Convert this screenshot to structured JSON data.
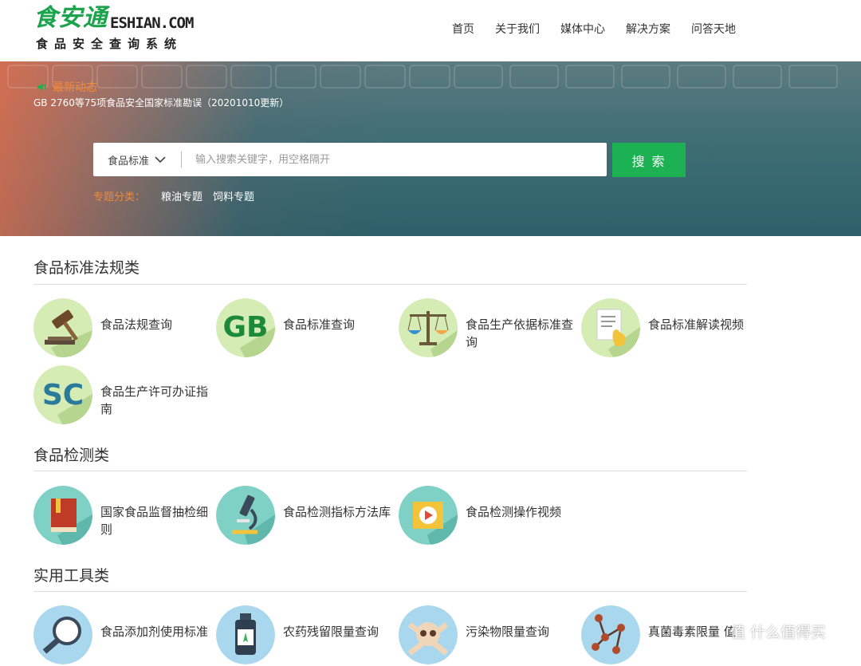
{
  "logo": {
    "main": "食安通",
    "domain": "ESHIAN.COM",
    "subtitle": "食品安全查询系统"
  },
  "nav": [
    "首页",
    "关于我们",
    "媒体中心",
    "解决方案",
    "问答天地"
  ],
  "news": {
    "heading": "最新动态",
    "text": "GB 2760等75项食品安全国家标准勘误（20201010更新）"
  },
  "search": {
    "category": "食品标准",
    "placeholder": "输入搜索关键字，用空格隔开",
    "button": "搜 索"
  },
  "topics": {
    "label": "专题分类：",
    "items": [
      "粮油专题",
      "饲料专题"
    ]
  },
  "sections": [
    {
      "title": "食品标准法规类",
      "items": [
        {
          "label": "食品法规查询",
          "icon": "gavel-icon"
        },
        {
          "label": "食品标准查询",
          "icon": "gb-icon"
        },
        {
          "label": "食品生产依据标准查询",
          "icon": "scale-icon"
        },
        {
          "label": "食品标准解读视频",
          "icon": "document-hand-icon"
        },
        {
          "label": "食品生产许可办证指南",
          "icon": "sc-icon"
        }
      ]
    },
    {
      "title": "食品检测类",
      "items": [
        {
          "label": "国家食品监督抽检细则",
          "icon": "book-icon"
        },
        {
          "label": "食品检测指标方法库",
          "icon": "microscope-icon"
        },
        {
          "label": "食品检测操作视频",
          "icon": "video-play-icon"
        }
      ]
    },
    {
      "title": "实用工具类",
      "items": [
        {
          "label": "食品添加剂使用标准",
          "icon": "magnifier-icon"
        },
        {
          "label": "农药残留限量查询",
          "icon": "pesticide-bottle-icon"
        },
        {
          "label": "污染物限量查询",
          "icon": "skull-icon"
        },
        {
          "label": "真菌毒素限量 值",
          "icon": "molecule-icon"
        }
      ]
    }
  ],
  "watermark": "值 什么值得买",
  "colors": {
    "brand_green": "#1cb152",
    "accent_orange": "#f08a3c",
    "icon_bg_green": "#d6ecb5",
    "icon_bg_teal": "#7fd1c6",
    "icon_bg_blue": "#a9d8ee"
  }
}
